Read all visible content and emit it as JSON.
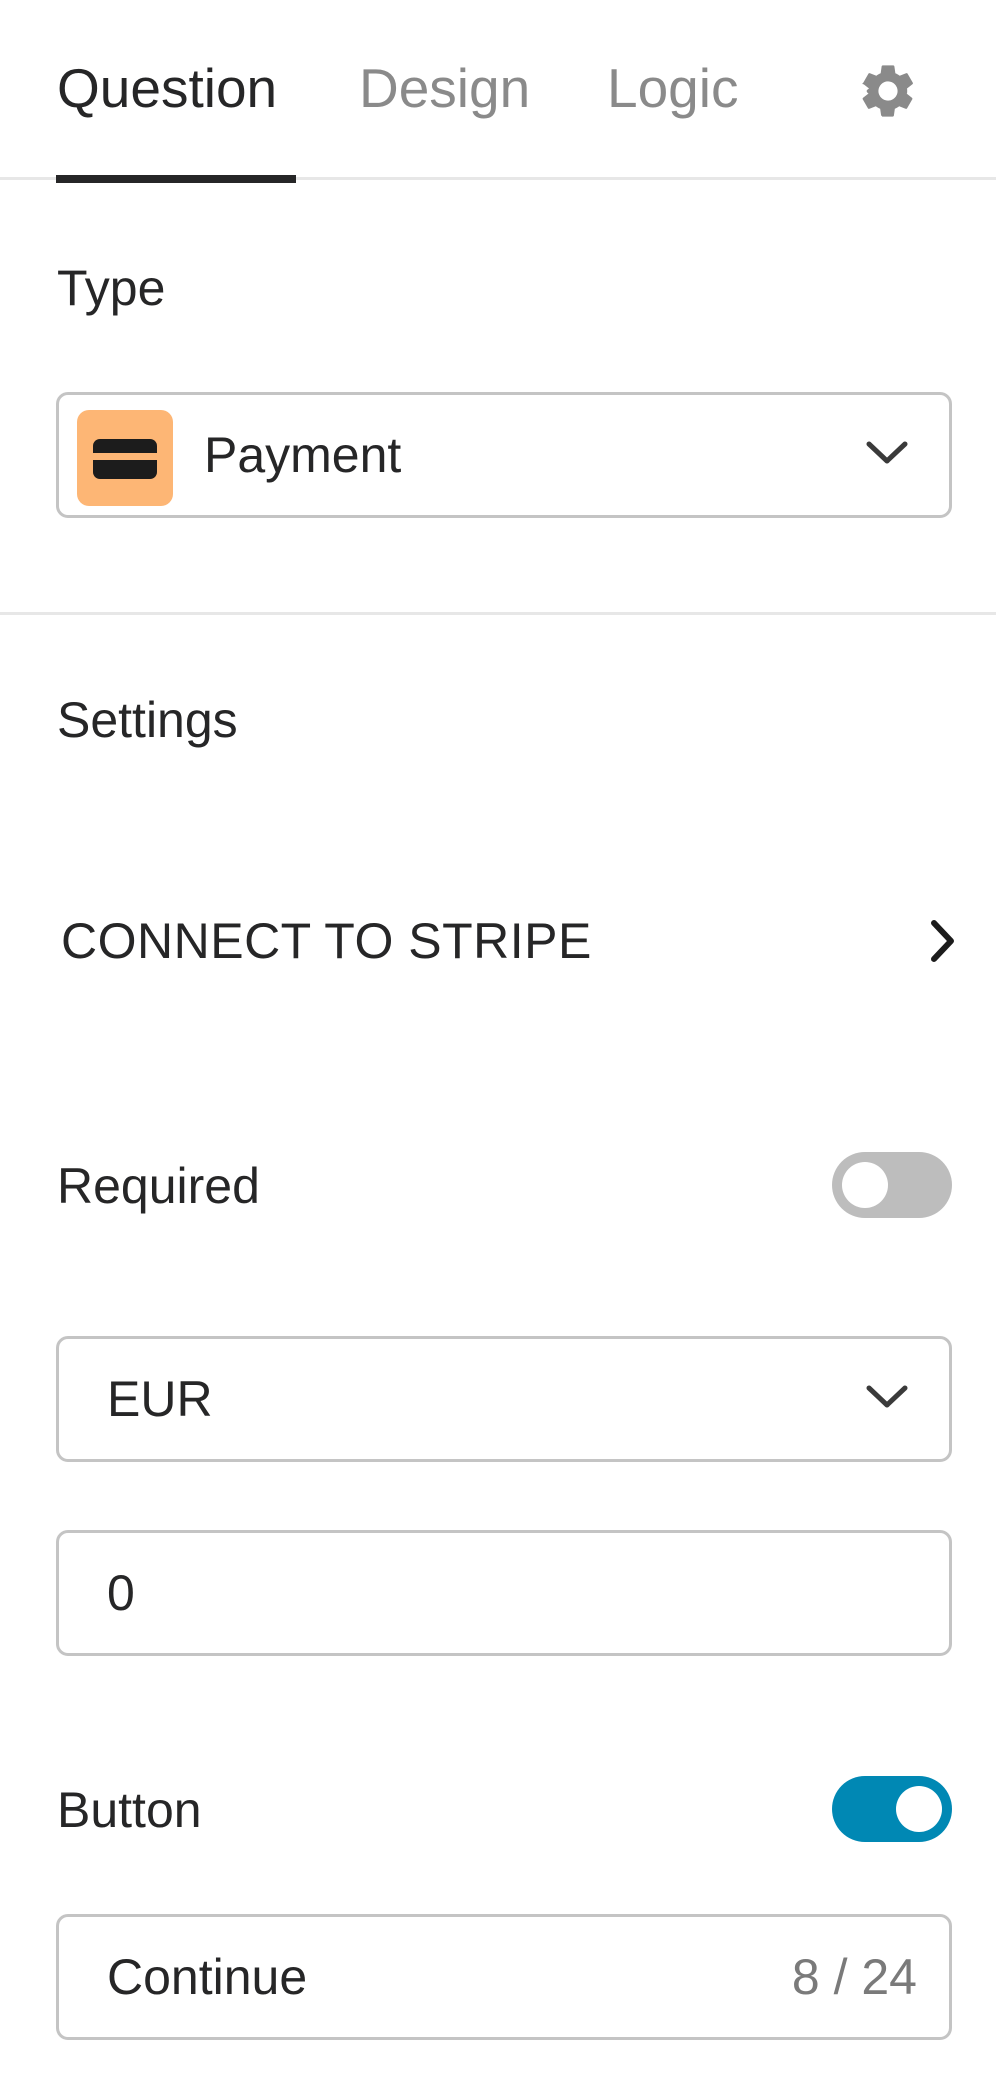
{
  "tabs": [
    {
      "label": "Question",
      "active": true
    },
    {
      "label": "Design",
      "active": false
    },
    {
      "label": "Logic",
      "active": false
    }
  ],
  "settings_icon": "gear-icon",
  "type_section": {
    "label": "Type",
    "selected": "Payment",
    "icon": "credit-card-icon",
    "icon_bg_color": "#fdb675"
  },
  "settings": {
    "heading": "Settings",
    "stripe_link": "CONNECT TO STRIPE",
    "required": {
      "label": "Required",
      "enabled": false
    },
    "currency": {
      "selected": "EUR"
    },
    "amount": {
      "value": "0"
    },
    "button": {
      "label": "Button",
      "enabled": true,
      "text": "Continue",
      "char_count": "8 / 24"
    }
  },
  "colors": {
    "toggle_on": "#0088b4",
    "toggle_off": "#bdbdbd",
    "text_primary": "#262627",
    "text_muted": "#8a8a8a"
  }
}
